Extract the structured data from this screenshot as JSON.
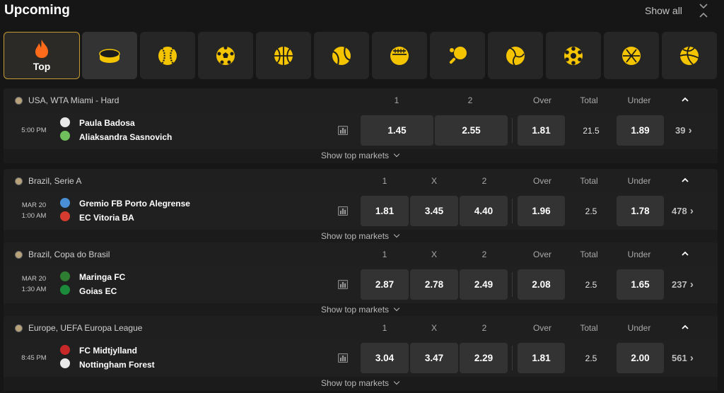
{
  "header": {
    "title": "Upcoming",
    "show_all": "Show all"
  },
  "tabs": [
    {
      "name": "top",
      "label": "Top",
      "icon": "fire-icon"
    },
    {
      "name": "ice-hockey",
      "icon": "ice-hockey-icon"
    },
    {
      "name": "baseball",
      "icon": "baseball-icon"
    },
    {
      "name": "football",
      "icon": "football-icon"
    },
    {
      "name": "basketball",
      "icon": "basketball-icon"
    },
    {
      "name": "tennis",
      "icon": "tennis-icon"
    },
    {
      "name": "american-football",
      "icon": "american-football-icon"
    },
    {
      "name": "table-tennis",
      "icon": "table-tennis-icon"
    },
    {
      "name": "volleyball",
      "icon": "volleyball-icon"
    },
    {
      "name": "futsal",
      "icon": "futsal-icon"
    },
    {
      "name": "water-polo",
      "icon": "water-polo-icon"
    },
    {
      "name": "beach-volleyball",
      "icon": "beach-volleyball-icon"
    }
  ],
  "colors": {
    "accent": "#f5c400",
    "fire": "#ff6b1a",
    "tab_bg": "#262626",
    "odd_bg": "#333333"
  },
  "events": [
    {
      "league": "USA, WTA Miami - Hard",
      "col_1": "1",
      "col_2": "2",
      "col_over": "Over",
      "col_total": "Total",
      "col_under": "Under",
      "time": "5:00 PM",
      "team1": "Paula Badosa",
      "team2": "Aliaksandra Sasnovich",
      "odd_1": "1.45",
      "odd_2": "2.55",
      "over": "1.81",
      "total": "21.5",
      "under": "1.89",
      "more": "39",
      "show_top": "Show top markets"
    },
    {
      "league": "Brazil, Serie A",
      "col_1": "1",
      "col_x": "X",
      "col_2": "2",
      "col_over": "Over",
      "col_total": "Total",
      "col_under": "Under",
      "date": "MAR 20",
      "time": "1:00 AM",
      "team1": "Gremio FB Porto Alegrense",
      "team2": "EC Vitoria BA",
      "odd_1": "1.81",
      "odd_x": "3.45",
      "odd_2": "4.40",
      "over": "1.96",
      "total": "2.5",
      "under": "1.78",
      "more": "478",
      "show_top": "Show top markets"
    },
    {
      "league": "Brazil, Copa do Brasil",
      "col_1": "1",
      "col_x": "X",
      "col_2": "2",
      "col_over": "Over",
      "col_total": "Total",
      "col_under": "Under",
      "date": "MAR 20",
      "time": "1:30 AM",
      "team1": "Maringa FC",
      "team2": "Goias EC",
      "odd_1": "2.87",
      "odd_x": "2.78",
      "odd_2": "2.49",
      "over": "2.08",
      "total": "2.5",
      "under": "1.65",
      "more": "237",
      "show_top": "Show top markets"
    },
    {
      "league": "Europe, UEFA Europa League",
      "col_1": "1",
      "col_x": "X",
      "col_2": "2",
      "col_over": "Over",
      "col_total": "Total",
      "col_under": "Under",
      "time": "8:45 PM",
      "team1": "FC Midtjylland",
      "team2": "Nottingham Forest",
      "odd_1": "3.04",
      "odd_x": "3.47",
      "odd_2": "2.29",
      "over": "1.81",
      "total": "2.5",
      "under": "2.00",
      "more": "561",
      "show_top": "Show top markets"
    }
  ]
}
